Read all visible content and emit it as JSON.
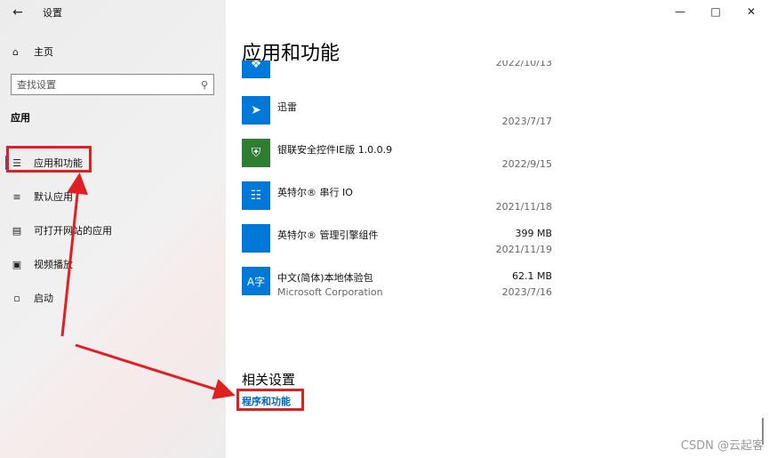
{
  "window": {
    "title": "设置",
    "back_icon": "back-arrow-icon",
    "controls": [
      "minimize-icon",
      "maximize-icon",
      "close-icon"
    ]
  },
  "sidebar": {
    "home_label": "主页",
    "search_placeholder": "查找设置",
    "section_title": "应用",
    "items": [
      {
        "label": "应用和功能",
        "icon": "list-icon",
        "active": true
      },
      {
        "label": "默认应用",
        "icon": "default-apps-icon",
        "active": false
      },
      {
        "label": "可打开网站的应用",
        "icon": "open-web-icon",
        "active": false
      },
      {
        "label": "视频播放",
        "icon": "video-icon",
        "active": false
      },
      {
        "label": "启动",
        "icon": "startup-icon",
        "active": false
      }
    ]
  },
  "main": {
    "title": "应用和功能",
    "apps": [
      {
        "name": "",
        "publisher": "",
        "size": "",
        "date": "2022/10/13",
        "icon_color": "#0078d7"
      },
      {
        "name": "迅雷",
        "publisher": "",
        "size": "",
        "date": "2023/7/17",
        "icon_color": "#1e88e5"
      },
      {
        "name": "银联安全控件IE版 1.0.0.9",
        "publisher": "",
        "size": "",
        "date": "2022/9/15",
        "icon_color": "#2e7d32"
      },
      {
        "name": "英特尔® 串行 IO",
        "publisher": "",
        "size": "",
        "date": "2021/11/18",
        "icon_color": "#0078d7"
      },
      {
        "name": "英特尔® 管理引擎组件",
        "publisher": "",
        "size": "399 MB",
        "date": "2021/11/19",
        "icon_color": "#0078d7"
      },
      {
        "name": "中文(简体)本地体验包",
        "publisher": "Microsoft Corporation",
        "size": "62.1 MB",
        "date": "2023/7/16",
        "icon_color": "#0078d7"
      }
    ],
    "related_title": "相关设置",
    "related_link": "程序和功能"
  },
  "watermark": "CSDN @云起客",
  "colors": {
    "accent": "#0067c0",
    "highlight": "#e02020",
    "tile": "#0078d7"
  }
}
